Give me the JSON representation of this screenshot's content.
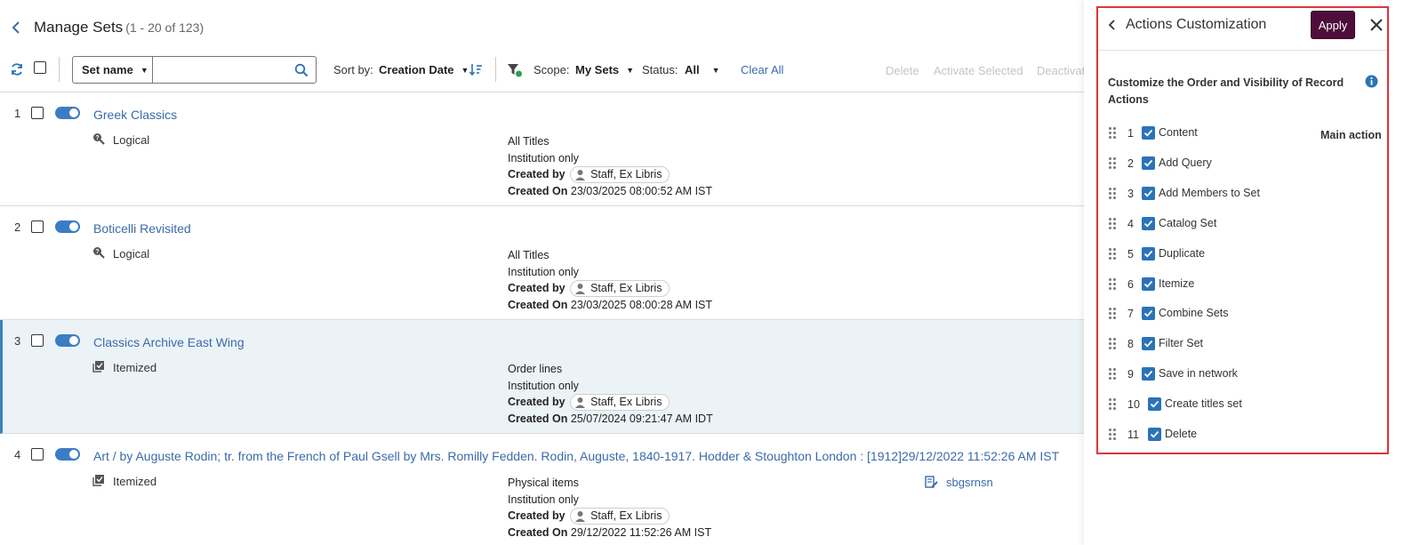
{
  "header": {
    "title": "Manage Sets",
    "count": "(1 - 20 of 123)"
  },
  "toolbar": {
    "field_select": "Set name",
    "search_value": "",
    "sort_label": "Sort by:",
    "sort_value": "Creation Date",
    "scope_label": "Scope:",
    "scope_value": "My Sets",
    "status_label": "Status:",
    "status_value": "All",
    "clear_all": "Clear All",
    "actions": [
      "Delete",
      "Activate Selected",
      "Deactivat"
    ]
  },
  "rows": [
    {
      "num": "1",
      "title": "Greek Classics",
      "type": "Logical",
      "content": "All Titles",
      "scope": "Institution only",
      "created_by_label": "Created by",
      "created_by": "Staff, Ex Libris",
      "created_on_label": "Created On",
      "created_on": "23/03/2025 08:00:52 AM IST"
    },
    {
      "num": "2",
      "title": "Boticelli Revisited",
      "type": "Logical",
      "content": "All Titles",
      "scope": "Institution only",
      "created_by_label": "Created by",
      "created_by": "Staff, Ex Libris",
      "created_on_label": "Created On",
      "created_on": "23/03/2025 08:00:28 AM IST"
    },
    {
      "num": "3",
      "title": "Classics Archive East Wing",
      "type": "Itemized",
      "content": "Order lines",
      "scope": "Institution only",
      "created_by_label": "Created by",
      "created_by": "Staff, Ex Libris",
      "created_on_label": "Created On",
      "created_on": "25/07/2024 09:21:47 AM IDT"
    },
    {
      "num": "4",
      "title": "Art / by Auguste Rodin; tr. from the French of Paul Gsell by Mrs. Romilly Fedden. Rodin, Auguste, 1840-1917. Hodder & Stoughton London : [1912]29/12/2022 11:52:26 AM IST",
      "type": "Itemized",
      "content": "Physical items",
      "scope": "Institution only",
      "created_by_label": "Created by",
      "created_by": "Staff, Ex Libris",
      "created_on_label": "Created On",
      "created_on": "29/12/2022 11:52:26 AM IST",
      "extra_link": "sbgsrnsn"
    }
  ],
  "panel": {
    "title": "Actions Customization",
    "apply": "Apply",
    "heading": "Customize the Order and Visibility of Record Actions",
    "main_action_label": "Main action",
    "actions": [
      {
        "num": "1",
        "label": "Content"
      },
      {
        "num": "2",
        "label": "Add Query"
      },
      {
        "num": "3",
        "label": "Add Members to Set"
      },
      {
        "num": "4",
        "label": "Catalog Set"
      },
      {
        "num": "5",
        "label": "Duplicate"
      },
      {
        "num": "6",
        "label": "Itemize"
      },
      {
        "num": "7",
        "label": "Combine Sets"
      },
      {
        "num": "8",
        "label": "Filter Set"
      },
      {
        "num": "9",
        "label": "Save in network"
      },
      {
        "num": "10",
        "label": "Create titles set"
      },
      {
        "num": "11",
        "label": "Delete"
      }
    ]
  },
  "colors": {
    "link": "#3b6aa9",
    "toggle": "#3b7dc4",
    "checkbox": "#2b73b8",
    "apply_bg": "#4e0d3a",
    "highlight_border": "#e0333a",
    "selected_row_bg": "#ecf3f7"
  }
}
